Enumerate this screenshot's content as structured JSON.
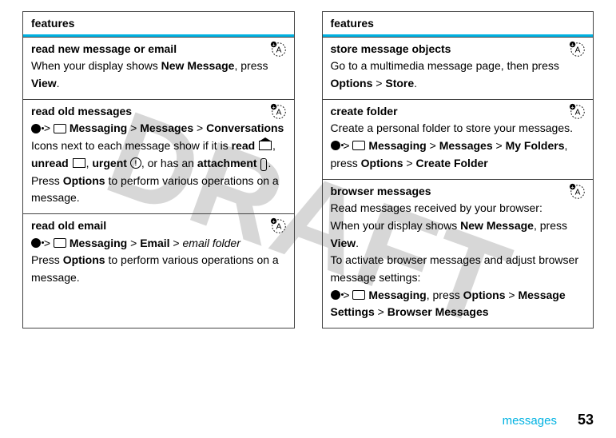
{
  "watermark": "DRAFT",
  "left": {
    "header": "features",
    "r1": {
      "title": "read new message or email",
      "text_a": "When your display shows ",
      "label_new_message": "New Message",
      "text_b": ", press ",
      "label_view": "View",
      "text_c": "."
    },
    "r2": {
      "title": "read old messages",
      "nav_gt1": " > ",
      "label_messaging": "Messaging",
      "nav_gt2": " > ",
      "label_messages": "Messages",
      "nav_gt3": " > ",
      "label_conversations": "Conversations",
      "p_a": "Icons next to each message show if it is ",
      "b_read": "read",
      "p_comma1": ", ",
      "b_unread": "unread",
      "p_comma2": ", ",
      "b_urgent": "urgent",
      "p_or": ", or has an ",
      "b_attach": "attachment",
      "p_dot": ". Press ",
      "label_options": "Options",
      "p_end": " to perform various operations on a message."
    },
    "r3": {
      "title": "read old email",
      "nav_gt1": " > ",
      "label_messaging": "Messaging",
      "nav_gt2": " > ",
      "label_email": "Email",
      "nav_gt3": " > ",
      "i_folder": "email folder",
      "p_a": "Press ",
      "label_options": "Options",
      "p_b": " to perform various operations on a message."
    }
  },
  "right": {
    "header": "features",
    "r1": {
      "title": "store message objects",
      "p_a": "Go to a multimedia message page, then press ",
      "label_options": "Options",
      "gt": " > ",
      "label_store": "Store",
      "dot": "."
    },
    "r2": {
      "title": "create folder",
      "p_a": "Create a personal folder to store your messages.",
      "nav_gt1": " > ",
      "label_messaging": "Messaging",
      "nav_gt2": " > ",
      "label_messages": "Messages",
      "nav_gt3": " > ",
      "label_myfolders": "My Folders",
      "p_press": ", press ",
      "label_options": "Options",
      "nav_gt4": " > ",
      "label_createfolder": "Create Folder"
    },
    "r3": {
      "title": "browser messages",
      "p_a": "Read messages received by your browser:",
      "p_b1": "When your display shows ",
      "label_new_message": "New Message",
      "p_b2": ", press ",
      "label_view": "View",
      "p_b3": ".",
      "p_c": "To activate browser messages and adjust browser message settings:",
      "nav_gt1": " > ",
      "label_messaging": "Messaging",
      "p_press": ", press ",
      "label_options": "Options",
      "nav_gt2": " > ",
      "label_msgsettings": "Message Settings",
      "nav_gt3": " > ",
      "label_browsermsg": "Browser Messages"
    }
  },
  "footer": {
    "label": "messages",
    "page": "53"
  }
}
